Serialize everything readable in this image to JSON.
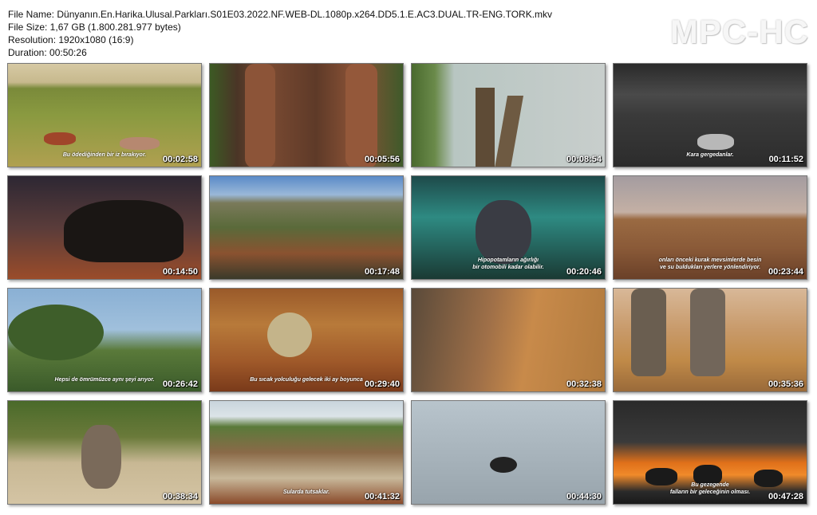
{
  "file_info": {
    "name": "File Name: Dünyanın.En.Harika.Ulusal.Parkları.S01E03.2022.NF.WEB-DL.1080p.x264.DD5.1.E.AC3.DUAL.TR-ENG.TORK.mkv",
    "size": "File Size: 1,67 GB (1.800.281.977 bytes)",
    "resolution": "Resolution: 1920x1080 (16:9)",
    "duration": "Duration: 00:50:26"
  },
  "logo": "MPC-HC",
  "thumbnails": [
    {
      "time": "00:02:58",
      "subtitle": "Bu ödediğinden bir iz bırakıyor."
    },
    {
      "time": "00:05:56",
      "subtitle": ""
    },
    {
      "time": "00:08:54",
      "subtitle": ""
    },
    {
      "time": "00:11:52",
      "subtitle": "Kara gergedanlar."
    },
    {
      "time": "00:14:50",
      "subtitle": ""
    },
    {
      "time": "00:17:48",
      "subtitle": ""
    },
    {
      "time": "00:20:46",
      "subtitle": "Hipopotamların ağırlığı\nbir otomobili kadar olabilir."
    },
    {
      "time": "00:23:44",
      "subtitle": "onları önceki kurak mevsimlerde besin\nve su buldukları yerlere yönlendiriyor."
    },
    {
      "time": "00:26:42",
      "subtitle": "Hepsi de ömrümüzce aynı şeyi arıyor."
    },
    {
      "time": "00:29:40",
      "subtitle": "Bu sıcak yolculuğu gelecek iki ay boyunca"
    },
    {
      "time": "00:32:38",
      "subtitle": ""
    },
    {
      "time": "00:35:36",
      "subtitle": ""
    },
    {
      "time": "00:38:34",
      "subtitle": ""
    },
    {
      "time": "00:41:32",
      "subtitle": "Sularda tutsaklar."
    },
    {
      "time": "00:44:30",
      "subtitle": ""
    },
    {
      "time": "00:47:28",
      "subtitle": "Bu gezegende\nfalların bir geleceğinin olması."
    }
  ]
}
